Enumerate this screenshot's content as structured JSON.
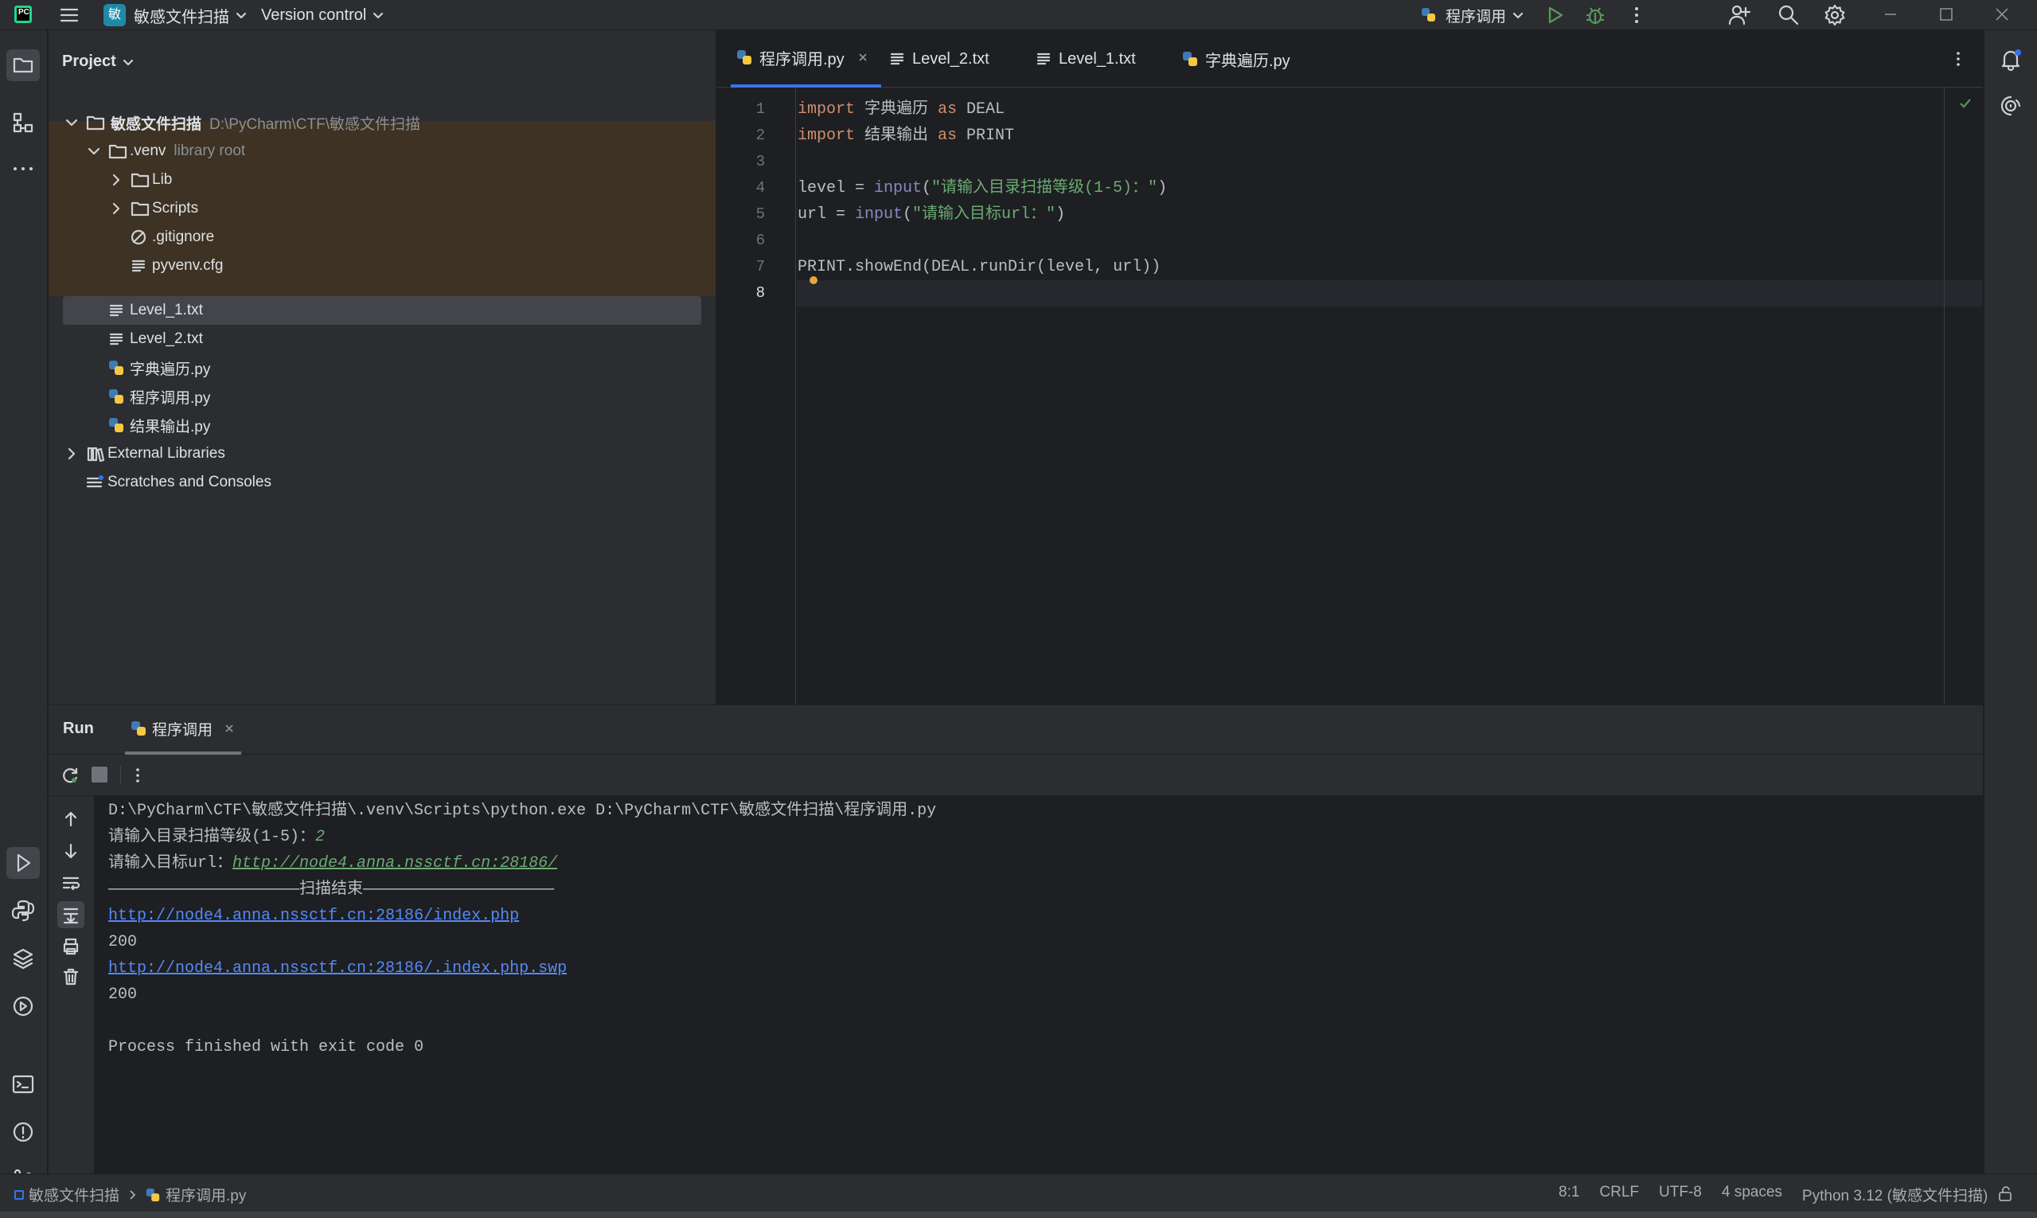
{
  "titlebar": {
    "project_badge": "敏",
    "project_name": "敏感文件扫描",
    "version_control": "Version control",
    "run_config": "程序调用"
  },
  "project_panel": {
    "title": "Project",
    "tree": [
      {
        "label": "敏感文件扫描",
        "hint": "D:\\PyCharm\\CTF\\敏感文件扫描",
        "type": "folder",
        "level": 0,
        "expanded": true
      },
      {
        "label": ".venv",
        "hint": "library root",
        "type": "folder",
        "level": 1,
        "expanded": true
      },
      {
        "label": "Lib",
        "type": "folder",
        "level": 2,
        "expanded": false
      },
      {
        "label": "Scripts",
        "type": "folder",
        "level": 2,
        "expanded": false
      },
      {
        "label": ".gitignore",
        "type": "ignore",
        "level": 2
      },
      {
        "label": "pyvenv.cfg",
        "type": "text",
        "level": 2
      },
      {
        "label": "Level_1.txt",
        "type": "text",
        "level": 1,
        "selected": true
      },
      {
        "label": "Level_2.txt",
        "type": "text",
        "level": 1
      },
      {
        "label": "字典遍历.py",
        "type": "python",
        "level": 1
      },
      {
        "label": "程序调用.py",
        "type": "python",
        "level": 1
      },
      {
        "label": "结果输出.py",
        "type": "python",
        "level": 1
      },
      {
        "label": "External Libraries",
        "type": "library",
        "level": 0,
        "expanded": false
      },
      {
        "label": "Scratches and Consoles",
        "type": "scratch",
        "level": 0
      }
    ]
  },
  "editor": {
    "tabs": [
      {
        "label": "程序调用.py",
        "icon": "python-file-icon",
        "active": true
      },
      {
        "label": "Level_2.txt",
        "icon": "text-file-icon"
      },
      {
        "label": "Level_1.txt",
        "icon": "text-file-icon"
      },
      {
        "label": "字典遍历.py",
        "icon": "python-file-icon"
      }
    ],
    "line_numbers": [
      "1",
      "2",
      "3",
      "4",
      "5",
      "6",
      "7",
      "8"
    ],
    "code": {
      "l1": {
        "kw1": "import",
        "mod": " 字典遍历 ",
        "kw2": "as",
        "alias": " DEAL"
      },
      "l2": {
        "kw1": "import",
        "mod": " 结果输出 ",
        "kw2": "as",
        "alias": " PRINT"
      },
      "l4": {
        "var": "level = ",
        "fn": "input",
        "open": "(",
        "str": "\"请输入目录扫描等级(1-5)：\"",
        "close": ")"
      },
      "l5": {
        "var": "url = ",
        "fn": "input",
        "open": "(",
        "str": "\"请输入目标url：\"",
        "close": ")"
      },
      "l7": {
        "text": "PRINT.showEnd(DEAL.runDir(level, url))"
      }
    }
  },
  "run_panel": {
    "title": "Run",
    "tab": "程序调用",
    "console": {
      "cmd": "D:\\PyCharm\\CTF\\敏感文件扫描\\.venv\\Scripts\\python.exe D:\\PyCharm\\CTF\\敏感文件扫描\\程序调用.py",
      "prompt_level": "请输入目录扫描等级(1-5)：",
      "input_level": "2",
      "prompt_url": "请输入目标url：",
      "input_url": "http://node4.anna.nssctf.cn:28186/",
      "divider": "————————————————————扫描结束————————————————————",
      "result1_url": "http://node4.anna.nssctf.cn:28186/index.php",
      "result1_code": "200",
      "result2_url": "http://node4.anna.nssctf.cn:28186/.index.php.swp",
      "result2_code": "200",
      "exit": "Process finished with exit code 0"
    }
  },
  "statusbar": {
    "breadcrumb_project": "敏感文件扫描",
    "breadcrumb_file": "程序调用.py",
    "position": "8:1",
    "line_sep": "CRLF",
    "encoding": "UTF-8",
    "indent": "4 spaces",
    "interpreter": "Python 3.12 (敏感文件扫描)"
  },
  "colors": {
    "accent": "#3574f0",
    "keyword": "#cf8e6d",
    "string": "#6aab73",
    "builtin": "#8888c6",
    "link": "#548af7",
    "excluded_bg": "#3d3223"
  }
}
